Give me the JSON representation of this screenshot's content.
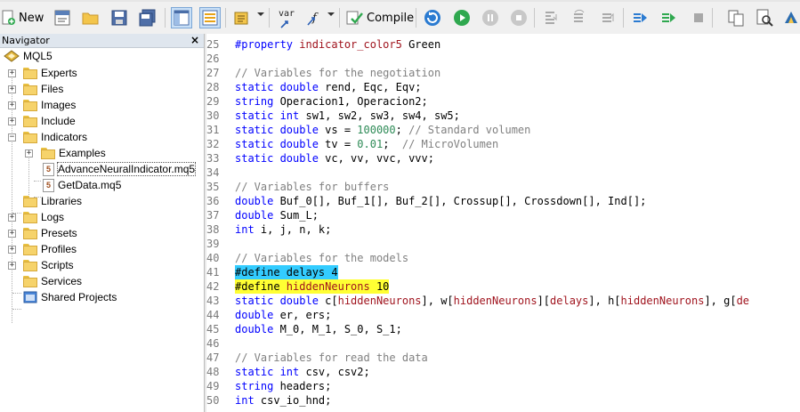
{
  "toolbar": {
    "new_label": "New",
    "compile_label": "Compile",
    "var_label": "var"
  },
  "navigator": {
    "title": "Navigator",
    "close_glyph": "×",
    "root": "MQL5",
    "items": [
      {
        "label": "Experts"
      },
      {
        "label": "Files"
      },
      {
        "label": "Images"
      },
      {
        "label": "Include"
      },
      {
        "label": "Indicators"
      },
      {
        "label": "Examples"
      },
      {
        "label": "AdvanceNeuralIndicator.mq5"
      },
      {
        "label": "GetData.mq5"
      },
      {
        "label": "Libraries"
      },
      {
        "label": "Logs"
      },
      {
        "label": "Presets"
      },
      {
        "label": "Profiles"
      },
      {
        "label": "Scripts"
      },
      {
        "label": "Services"
      },
      {
        "label": "Shared Projects"
      }
    ]
  },
  "editor": {
    "line_numbers": [
      "25",
      "26",
      "27",
      "28",
      "29",
      "30",
      "31",
      "32",
      "33",
      "34",
      "35",
      "36",
      "37",
      "38",
      "39",
      "40",
      "41",
      "42",
      "43",
      "44",
      "45",
      "46",
      "47",
      "48",
      "49",
      "50"
    ],
    "lines": {
      "l25": {
        "a": "#property ",
        "b": "indicator_color5",
        "c": " Green"
      },
      "l27": {
        "a": "// Variables for the negotiation"
      },
      "l28": {
        "a": "static double",
        "b": " rend, Eqc, Eqv;"
      },
      "l29": {
        "a": "string",
        "b": " Operacion1, Operacion2;"
      },
      "l30": {
        "a": "static int",
        "b": " sw1, sw2, sw3, sw4, sw5;"
      },
      "l31": {
        "a": "static double",
        "b": " vs = ",
        "c": "100000",
        "d": "; ",
        "e": "// Standard volumen"
      },
      "l32": {
        "a": "static double",
        "b": " tv = ",
        "c": "0.01",
        "d": ";  ",
        "e": "// MicroVolumen"
      },
      "l33": {
        "a": "static double",
        "b": " vc, vv, vvc, vvv;"
      },
      "l35": {
        "a": "// Variables for buffers"
      },
      "l36": {
        "a": "double",
        "b": " Buf_0[], Buf_1[], Buf_2[], Crossup[], Crossdown[], Ind[];"
      },
      "l37": {
        "a": "double",
        "b": " Sum_L;"
      },
      "l38": {
        "a": "int",
        "b": " i, j, n, k;"
      },
      "l40": {
        "a": "// Variables for the models"
      },
      "l41": {
        "a": "#define delays 4"
      },
      "l42": {
        "a": "#define ",
        "b": "hiddenNeurons",
        "c": " 10"
      },
      "l43": {
        "a": "static double",
        "b": " c[",
        "c": "hiddenNeurons",
        "d": "], w[",
        "e": "hiddenNeurons",
        "f": "][",
        "g": "delays",
        "h": "], h[",
        "i": "hiddenNeurons",
        "j": "], g[",
        "k": "de"
      },
      "l44": {
        "a": "double",
        "b": " er, ers;"
      },
      "l45": {
        "a": "double",
        "b": " M_0, M_1, S_0, S_1;"
      },
      "l47": {
        "a": "// Variables for read the data"
      },
      "l48": {
        "a": "static int",
        "b": " csv, csv2;"
      },
      "l49": {
        "a": "string",
        "b": " headers;"
      },
      "l50": {
        "a": "int",
        "b": " csv_io_hnd;"
      }
    }
  },
  "colors": {
    "keyword": "#0000ff",
    "comment": "#808080",
    "number": "#2e8b57",
    "macro": "#a0141e",
    "highlight_cyan": "#33ccff",
    "highlight_yellow": "#ffff33"
  }
}
